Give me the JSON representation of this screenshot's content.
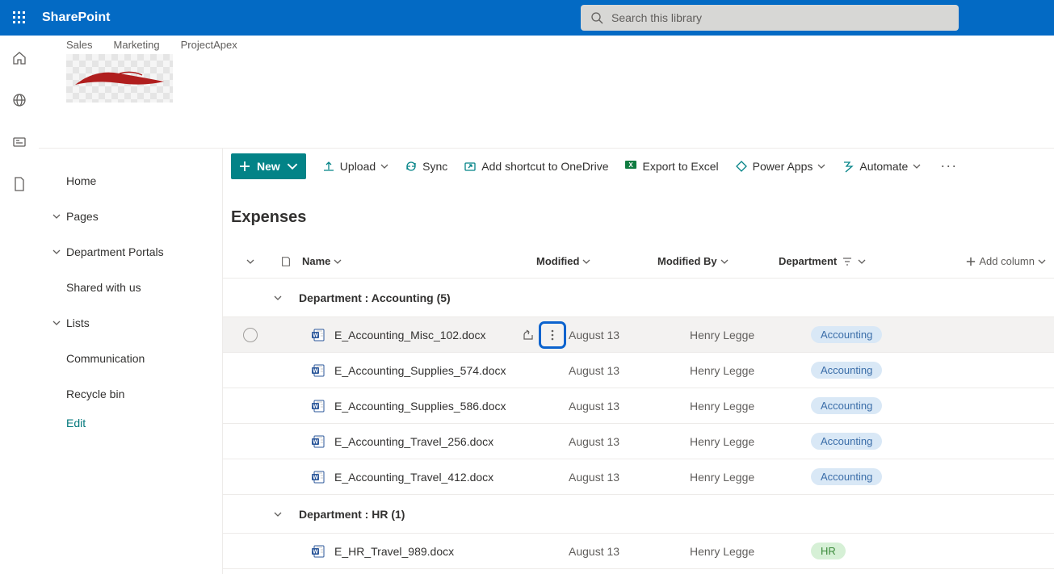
{
  "header": {
    "app_name": "SharePoint",
    "search_placeholder": "Search this library"
  },
  "site_tabs": [
    "Sales",
    "Marketing",
    "ProjectApex"
  ],
  "left_nav": {
    "items": [
      {
        "label": "Home",
        "chevron": false
      },
      {
        "label": "Pages",
        "chevron": true
      },
      {
        "label": "Department Portals",
        "chevron": true
      },
      {
        "label": "Shared with us",
        "chevron": false
      },
      {
        "label": "Lists",
        "chevron": true
      },
      {
        "label": "Communication",
        "chevron": false
      },
      {
        "label": "Recycle bin",
        "chevron": false
      }
    ],
    "edit_label": "Edit"
  },
  "commands": {
    "new": "New",
    "upload": "Upload",
    "sync": "Sync",
    "shortcut": "Add shortcut to OneDrive",
    "export": "Export to Excel",
    "powerapps": "Power Apps",
    "automate": "Automate"
  },
  "library": {
    "title": "Expenses",
    "columns": {
      "name": "Name",
      "modified": "Modified",
      "modified_by": "Modified By",
      "department": "Department",
      "add": "Add column"
    },
    "groups": [
      {
        "label": "Department : Accounting (5)",
        "rows": [
          {
            "name": "E_Accounting_Misc_102.docx",
            "modified": "August 13",
            "modified_by": "Henry Legge",
            "dept": "Accounting",
            "dept_class": "accounting",
            "hovered": true
          },
          {
            "name": "E_Accounting_Supplies_574.docx",
            "modified": "August 13",
            "modified_by": "Henry Legge",
            "dept": "Accounting",
            "dept_class": "accounting"
          },
          {
            "name": "E_Accounting_Supplies_586.docx",
            "modified": "August 13",
            "modified_by": "Henry Legge",
            "dept": "Accounting",
            "dept_class": "accounting"
          },
          {
            "name": "E_Accounting_Travel_256.docx",
            "modified": "August 13",
            "modified_by": "Henry Legge",
            "dept": "Accounting",
            "dept_class": "accounting"
          },
          {
            "name": "E_Accounting_Travel_412.docx",
            "modified": "August 13",
            "modified_by": "Henry Legge",
            "dept": "Accounting",
            "dept_class": "accounting"
          }
        ]
      },
      {
        "label": "Department : HR (1)",
        "rows": [
          {
            "name": "E_HR_Travel_989.docx",
            "modified": "August 13",
            "modified_by": "Henry Legge",
            "dept": "HR",
            "dept_class": "hr"
          }
        ]
      }
    ]
  }
}
